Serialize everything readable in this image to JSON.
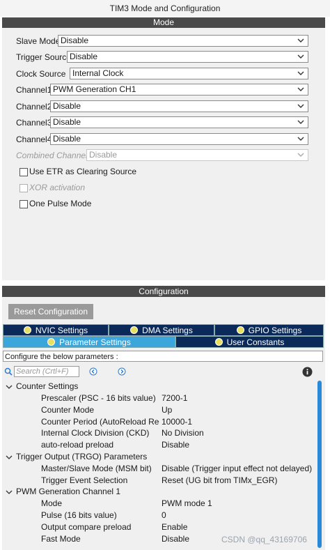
{
  "window_title": "TIM3 Mode and Configuration",
  "mode_header": "Mode",
  "mode_fields": [
    {
      "label": "Slave Mode",
      "value": "Disable"
    },
    {
      "label": "Trigger Source",
      "value": "Disable"
    },
    {
      "label": "Clock Source",
      "value": "Internal Clock"
    },
    {
      "label": "Channel1",
      "value": "PWM Generation CH1"
    },
    {
      "label": "Channel2",
      "value": "Disable"
    },
    {
      "label": "Channel3",
      "value": "Disable"
    },
    {
      "label": "Channel4",
      "value": "Disable"
    },
    {
      "label": "Combined Channels",
      "value": "Disable",
      "disabled": true
    }
  ],
  "checkboxes": [
    {
      "label": "Use ETR as Clearing Source",
      "checked": false
    },
    {
      "label": "XOR activation",
      "checked": false,
      "disabled": true
    },
    {
      "label": "One Pulse Mode",
      "checked": false
    }
  ],
  "config_header": "Configuration",
  "reset_button": "Reset Configuration",
  "tabs": {
    "nvic": "NVIC Settings",
    "dma": "DMA Settings",
    "gpio": "GPIO Settings",
    "parameter": "Parameter Settings",
    "user_constants": "User Constants"
  },
  "configure_text": "Configure the below parameters :",
  "search_placeholder": "Search (Crtl+F)",
  "tree": {
    "counter_settings": {
      "title": "Counter Settings",
      "items": [
        {
          "name": "Prescaler (PSC - 16 bits value)",
          "value": "7200-1"
        },
        {
          "name": "Counter Mode",
          "value": "Up"
        },
        {
          "name": "Counter Period (AutoReload Regi...",
          "value": "10000-1"
        },
        {
          "name": "Internal Clock Division (CKD)",
          "value": "No Division"
        },
        {
          "name": "auto-reload preload",
          "value": "Disable"
        }
      ]
    },
    "trigger_output": {
      "title": "Trigger Output (TRGO) Parameters",
      "items": [
        {
          "name": "Master/Slave Mode (MSM bit)",
          "value": "Disable (Trigger input effect not delayed)"
        },
        {
          "name": "Trigger Event Selection",
          "value": "Reset (UG bit from TIMx_EGR)"
        }
      ]
    },
    "pwm_channel1": {
      "title": "PWM Generation Channel 1",
      "items": [
        {
          "name": "Mode",
          "value": "PWM mode 1"
        },
        {
          "name": "Pulse (16 bits value)",
          "value": "0"
        },
        {
          "name": "Output compare preload",
          "value": "Enable"
        },
        {
          "name": "Fast Mode",
          "value": "Disable"
        }
      ]
    }
  },
  "watermark": "CSDN @qq_43169706",
  "colors": {
    "header_bar": "#4a4a4a",
    "tab_dark": "#0b2a5a",
    "tab_active": "#3aa6dc",
    "scrollbar": "#2a8ad8"
  },
  "icons": [
    "chevron-down-icon",
    "search-icon",
    "left-arrow-icon",
    "right-arrow-icon",
    "info-icon",
    "status-dot-icon",
    "expand-chevron-icon"
  ]
}
